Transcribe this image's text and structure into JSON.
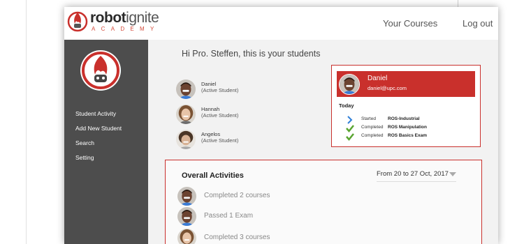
{
  "brand": {
    "name_bold": "robot",
    "name_light": "ignite",
    "tagline": "ACADEMY",
    "accent_color": "#c9302c",
    "logo_icon": "flame-robot-icon"
  },
  "header": {
    "nav": [
      {
        "label": "Your Courses"
      },
      {
        "label": "Log out"
      }
    ]
  },
  "sidebar": {
    "emblem_icon": "flame-robot-emblem-icon",
    "items": [
      {
        "label": "Student Activity"
      },
      {
        "label": "Add New Student"
      },
      {
        "label": "Search"
      },
      {
        "label": "Setting"
      }
    ]
  },
  "main": {
    "greeting": "Hi  Pro. Steffen, this is your students",
    "students": [
      {
        "name": "Daniel",
        "status": "(Active Student)"
      },
      {
        "name": "Hannah",
        "status": "(Active Student)"
      },
      {
        "name": "Angelos",
        "status": "(Active Student)"
      }
    ],
    "detail": {
      "name": "Daniel",
      "email": "daniel@upc.com",
      "today_label": "Today",
      "activities": [
        {
          "icon": "chevron-right-icon",
          "status": "Started",
          "course": "ROS-Industrial"
        },
        {
          "icon": "check-icon",
          "status": "Completed",
          "course": "ROS Manipulation"
        },
        {
          "icon": "check-icon",
          "status": "Completed",
          "course": "ROS Basics Exam"
        }
      ]
    },
    "overall": {
      "title": "Overall Activities",
      "range": "From 20 to 27 Oct, 2017",
      "items": [
        {
          "text": "Completed 2 courses"
        },
        {
          "text": "Passed 1 Exam"
        },
        {
          "text": "Completed 3 courses"
        }
      ]
    }
  },
  "colors": {
    "sidebar_bg": "#4d4d4d",
    "main_bg": "#f2f2f2",
    "check_green": "#5aa531",
    "chevron_blue": "#2f7fd8"
  }
}
